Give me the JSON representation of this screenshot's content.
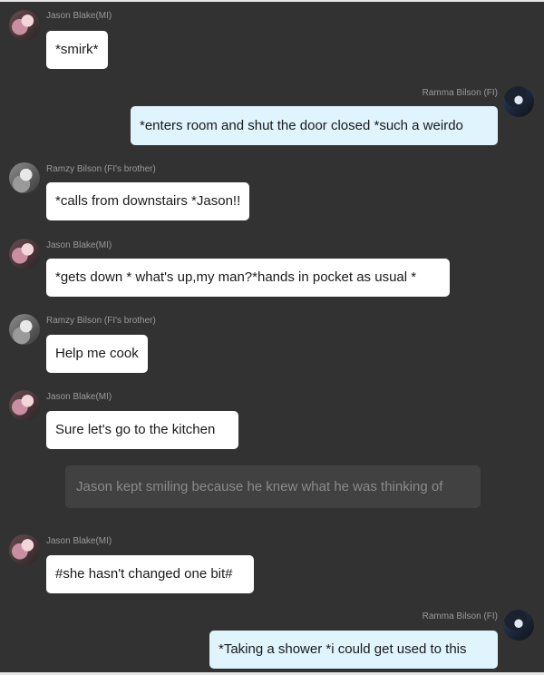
{
  "messages": [
    {
      "sender": "Jason Blake(MI)",
      "text": "*smirk*"
    },
    {
      "sender": "Ramma Bilson (FI)",
      "text": "*enters room and shut the door closed *such a weirdo"
    },
    {
      "sender": "Ramzy Bilson (FI's brother)",
      "text": "*calls from downstairs *Jason!!"
    },
    {
      "sender": "Jason Blake(MI)",
      "text": "*gets down * what's up,my man?*hands in pocket as usual *"
    },
    {
      "sender": "Ramzy Bilson (FI's brother)",
      "text": "Help me cook"
    },
    {
      "sender": "Jason Blake(MI)",
      "text": "Sure let's go to the kitchen"
    },
    {
      "sender": "",
      "text": "Jason kept smiling because he knew what he was thinking of"
    },
    {
      "sender": "Jason Blake(MI)",
      "text": "#she hasn't changed one bit#"
    },
    {
      "sender": "Ramma Bilson (FI)",
      "text": "*Taking a shower *i could get used to this"
    }
  ],
  "colors": {
    "background": "#323232",
    "own_bubble": "#dff4fd",
    "other_bubble": "#ffffff",
    "narration_bubble": "#414141"
  }
}
